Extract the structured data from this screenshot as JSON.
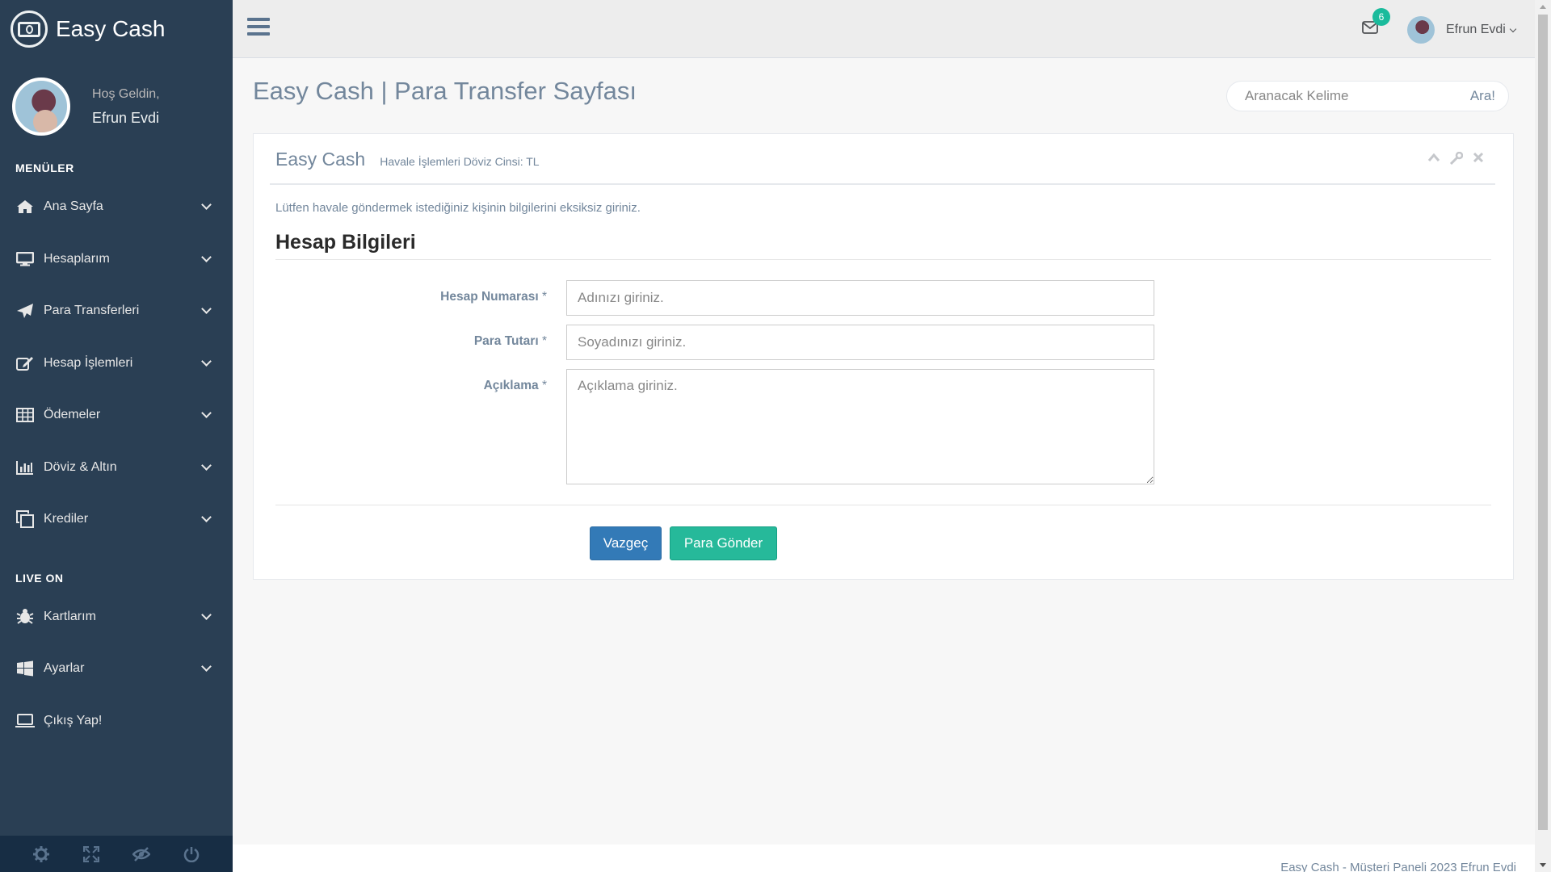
{
  "brand": {
    "title": "Easy Cash",
    "icon": "money-icon"
  },
  "profile": {
    "welcome": "Hoş Geldin,",
    "name": "Efrun Evdi"
  },
  "sidebar": {
    "section1": "MENÜLER",
    "items": [
      {
        "label": "Ana Sayfa",
        "icon": "home-icon"
      },
      {
        "label": "Hesaplarım",
        "icon": "desktop-icon"
      },
      {
        "label": "Para Transferleri",
        "icon": "paper-plane-icon"
      },
      {
        "label": "Hesap İşlemleri",
        "icon": "edit-icon"
      },
      {
        "label": "Ödemeler",
        "icon": "table-icon"
      },
      {
        "label": "Döviz & Altın",
        "icon": "bar-chart-icon"
      },
      {
        "label": "Krediler",
        "icon": "clone-icon"
      }
    ],
    "section2": "LIVE ON",
    "items2": [
      {
        "label": "Kartlarım",
        "icon": "bug-icon"
      },
      {
        "label": "Ayarlar",
        "icon": "windows-icon"
      },
      {
        "label": "Çıkış Yap!",
        "icon": "laptop-icon"
      }
    ],
    "footer_icons": [
      "settings-icon",
      "fullscreen-icon",
      "lock-icon",
      "power-icon"
    ]
  },
  "topnav": {
    "mail_count": "6",
    "user_name": "Efrun Evdi"
  },
  "page": {
    "title": "Easy Cash | Para Transfer Sayfası"
  },
  "search": {
    "placeholder": "Aranacak Kelime",
    "button": "Ara!"
  },
  "panel": {
    "title": "Easy Cash",
    "subtitle": "Havale İşlemleri Döviz Cinsi: TL",
    "intro": "Lütfen havale göndermek istediğiniz kişinin bilgilerini eksiksiz giriniz.",
    "section": "Hesap Bilgileri"
  },
  "form": {
    "account_label": "Hesap Numarası",
    "account_placeholder": "Adınızı giriniz.",
    "amount_label": "Para Tutarı",
    "amount_placeholder": "Soyadınızı giriniz.",
    "desc_label": "Açıklama",
    "desc_placeholder": "Açıklama giriniz.",
    "required_mark": "*",
    "cancel": "Vazgeç",
    "submit": "Para Gönder"
  },
  "footer": {
    "text": "Easy Cash - Müşteri Paneli 2023 Efrun Evdi"
  },
  "colors": {
    "sidebar": "#2a3f54",
    "accent": "#1abb9c",
    "primary": "#337ab7",
    "success": "#26b99a"
  }
}
